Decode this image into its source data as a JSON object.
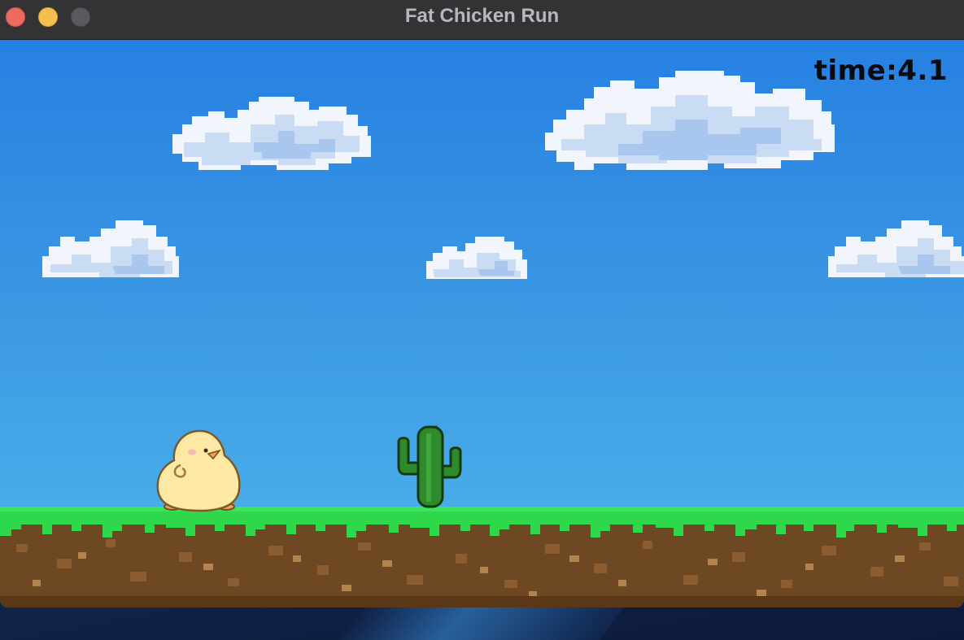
{
  "window": {
    "title": "Fat Chicken Run"
  },
  "hud": {
    "time_label": "time",
    "time_separator": ":",
    "time_value": "4.1"
  },
  "scene": {
    "sky_color": "#3a97e3",
    "grass_color": "#2ed84a",
    "dirt_color": "#6e4723",
    "sprites": [
      "chicken-icon",
      "cactus-icon",
      "cloud-icon"
    ]
  }
}
